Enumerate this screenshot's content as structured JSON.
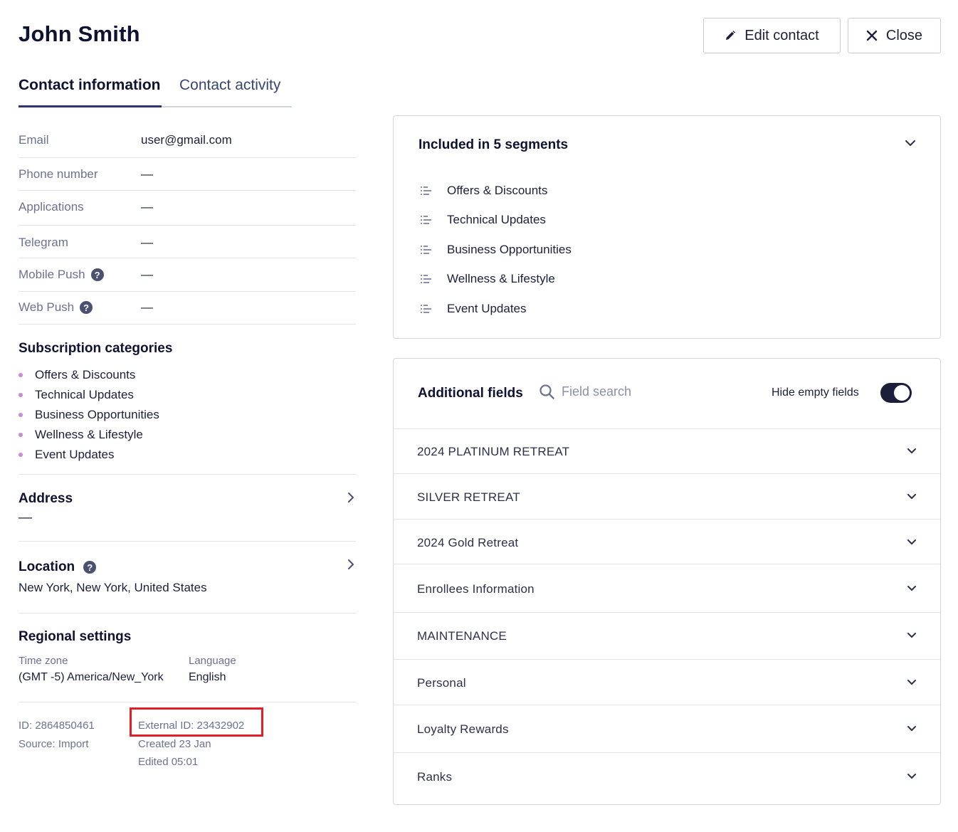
{
  "header": {
    "contact_name": "John Smith",
    "edit_label": "Edit contact",
    "close_label": "Close"
  },
  "tabs": [
    {
      "label": "Contact information",
      "active": true
    },
    {
      "label": "Contact activity",
      "active": false
    }
  ],
  "contact_fields": [
    {
      "label": "Email",
      "value": "user@gmail.com"
    },
    {
      "label": "Phone number",
      "value": "—"
    },
    {
      "label": "Applications",
      "value": "—"
    },
    {
      "label": "Telegram",
      "value": "—"
    },
    {
      "label": "Mobile Push",
      "value": "—"
    },
    {
      "label": "Web Push",
      "value": "—"
    }
  ],
  "subscription": {
    "title": "Subscription categories",
    "items": [
      "Offers & Discounts",
      "Technical Updates",
      "Business Opportunities",
      "Wellness & Lifestyle",
      "Event Updates"
    ]
  },
  "address": {
    "title": "Address",
    "value": "—"
  },
  "location": {
    "title": "Location",
    "value": "New York, New York, United States"
  },
  "regional": {
    "title": "Regional settings",
    "timezone_label": "Time zone",
    "timezone_value": "(GMT -5) America/New_York",
    "language_label": "Language",
    "language_value": "English"
  },
  "meta": {
    "id": "ID: 2864850461",
    "source": "Source: Import",
    "external_id": "External ID: 23432902",
    "created": "Created 23 Jan",
    "edited": "Edited 05:01"
  },
  "segments": {
    "title": "Included in  5 segments",
    "items": [
      "Offers & Discounts",
      "Technical Updates",
      "Business Opportunities",
      "Wellness & Lifestyle",
      "Event Updates"
    ]
  },
  "additional_fields": {
    "title": "Additional fields",
    "search_placeholder": "Field search",
    "hide_empty_label": "Hide empty fields",
    "hide_empty_on": true,
    "groups": [
      "2024 PLATINUM RETREAT",
      "SILVER RETREAT",
      "2024 Gold Retreat",
      "Enrollees Information",
      "MAINTENANCE",
      "Personal",
      "Loyalty Rewards",
      "Ranks"
    ]
  },
  "colors": {
    "accent": "#2c3571",
    "bullet": "#c88bd6",
    "highlight": "#e01f26"
  }
}
